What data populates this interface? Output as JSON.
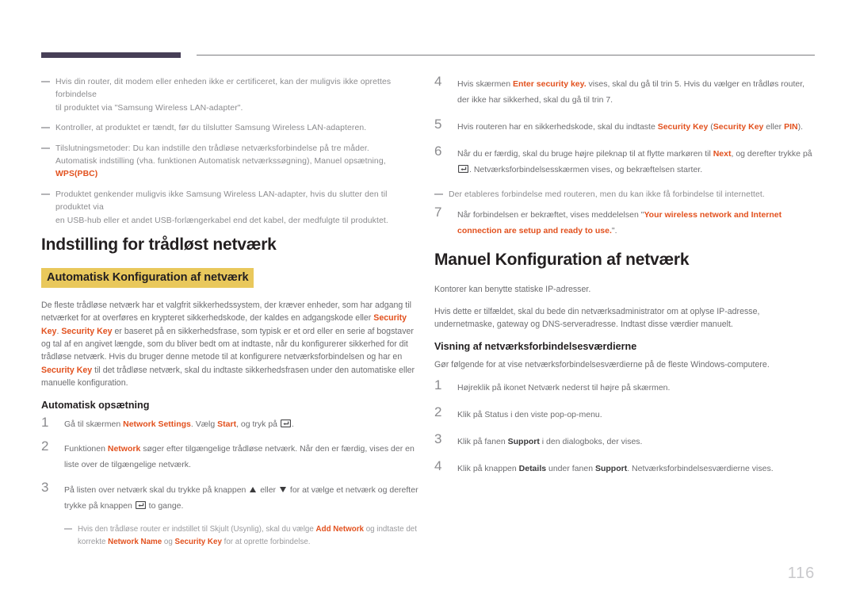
{
  "page": {
    "number": "116",
    "accent_orange": "#e2511e",
    "highlight_yellow": "#e9c85c",
    "header_bar_color": "#473f57",
    "header_line_color": "#7d7d80"
  },
  "left_column": {
    "notes": [
      {
        "id": "note-router-not-certified",
        "lines": [
          "Hvis din router, dit modem eller enheden ikke er certificeret, kan der muligvis ikke oprettes forbindelse",
          "til produktet via \"Samsung Wireless LAN-adapter\"."
        ]
      },
      {
        "id": "note-product-on",
        "lines": [
          "Kontroller, at produktet er tændt, før du tilslutter Samsung Wireless LAN-adapteren."
        ]
      },
      {
        "id": "note-connection-methods",
        "lines": [
          "Tilslutningsmetoder: Du kan indstille den trådløse netværksforbindelse på tre måder.",
          "Automatisk indstilling (vha. funktionen Automatisk netværkssøgning), Manuel opsætning, "
        ],
        "trailing_bold": "WPS(PBC)"
      },
      {
        "id": "note-usb-hub",
        "lines": [
          "Produktet genkender muligvis ikke Samsung Wireless LAN-adapter, hvis du slutter den til produktet via",
          "en USB-hub eller et andet USB-forlængerkabel end det kabel, der medfulgte til produktet."
        ]
      }
    ],
    "section_title": "Indstilling for trådløst netværk",
    "highlight_heading": "Automatisk Konfiguration af netværk",
    "intro_paragraph": {
      "l1_a": "De fleste trådløse netværk har et valgfrit sikkerhedssystem, der kræver enheder, som har adgang til",
      "l2_a": "netværket for at overføres en krypteret sikkerhedskode, der kaldes en adgangskode eller ",
      "l2_b": "Security Key",
      "l2_c": ".",
      "l3_a": "Security Key",
      "l3_b": " er baseret på en sikkerhedsfrase, som typisk er et ord eller en serie af bogstaver og tal af en",
      "l4_a": "angivet længde, som du bliver bedt om at indtaste, når du konfigurerer sikkerhed for dit trådløse netværk.",
      "l5_a": "Hvis du bruger denne metode til at konfigurere netværksforbindelsen og har en ",
      "l5_b": "Security Key",
      "l5_c": " til det",
      "l6_a": "trådløse netværk, skal du indtaste sikkerhedsfrasen under den automatiske eller manuelle konfiguration."
    },
    "sub_title": "Automatisk opsætning",
    "steps": [
      {
        "num": "1",
        "parts": [
          {
            "t": "Gå til skærmen ",
            "s": "plain"
          },
          {
            "t": "Network Settings",
            "s": "orange"
          },
          {
            "t": ". Vælg ",
            "s": "plain"
          },
          {
            "t": "Start",
            "s": "orange"
          },
          {
            "t": ", og tryk på ",
            "s": "plain"
          },
          {
            "t": "[enter-key]",
            "s": "icon-enter"
          },
          {
            "t": ".",
            "s": "plain"
          }
        ]
      },
      {
        "num": "2",
        "parts": [
          {
            "t": "Funktionen ",
            "s": "plain"
          },
          {
            "t": "Network",
            "s": "orange"
          },
          {
            "t": " søger efter tilgængelige trådløse netværk. Når den er færdig, vises der en liste over de tilgængelige netværk.",
            "s": "plain"
          }
        ]
      },
      {
        "num": "3",
        "parts": [
          {
            "t": "På listen over netværk skal du trykke på knappen ",
            "s": "plain"
          },
          {
            "t": "[tri-up]",
            "s": "icon-tri-up"
          },
          {
            "t": " eller ",
            "s": "plain"
          },
          {
            "t": "[tri-down]",
            "s": "icon-tri-down"
          },
          {
            "t": " for at vælge et netværk og derefter trykke på knappen ",
            "s": "plain"
          },
          {
            "t": "[enter-key]",
            "s": "icon-enter"
          },
          {
            "t": " to gange.",
            "s": "plain"
          }
        ]
      }
    ],
    "subnote": {
      "p1": "Hvis den trådløse router er indstillet til Skjult (Usynlig), skal du vælge ",
      "b1": "Add Network",
      "p2": " og indtaste det korrekte ",
      "b2": "Network Name",
      "p3": " og ",
      "b3": "Security Key",
      "p4": " for at oprette forbindelse."
    }
  },
  "right_column": {
    "steps_top": [
      {
        "num": "4",
        "parts": [
          {
            "t": "Hvis skærmen ",
            "s": "plain"
          },
          {
            "t": "Enter security key.",
            "s": "orange"
          },
          {
            "t": " vises, skal du gå til trin 5. Hvis du vælger en trådløs router, der ikke har sikkerhed, skal du gå til trin 7.",
            "s": "plain"
          }
        ]
      },
      {
        "num": "5",
        "parts": [
          {
            "t": "Hvis routeren har en sikkerhedskode, skal du indtaste ",
            "s": "plain"
          },
          {
            "t": "Security Key",
            "s": "orange"
          },
          {
            "t": " (",
            "s": "plain"
          },
          {
            "t": "Security Key",
            "s": "orange"
          },
          {
            "t": " eller ",
            "s": "plain"
          },
          {
            "t": "PIN",
            "s": "orange"
          },
          {
            "t": ").",
            "s": "plain"
          }
        ]
      },
      {
        "num": "6",
        "parts": [
          {
            "t": "Når du er færdig, skal du bruge højre pileknap til at flytte markøren til ",
            "s": "plain"
          },
          {
            "t": "Next",
            "s": "orange"
          },
          {
            "t": ", og derefter trykke på ",
            "s": "plain"
          },
          {
            "t": "[enter-key]",
            "s": "icon-enter"
          },
          {
            "t": ". Netværksforbindelsesskærmen vises, og bekræftelsen starter.",
            "s": "plain"
          }
        ]
      }
    ],
    "note_internet": "Der etableres forbindelse med routeren, men du kan ikke få forbindelse til internettet.",
    "step_seven": {
      "num": "7",
      "p1": "Når forbindelsen er bekræftet, vises meddelelsen \"",
      "b1": "Your wireless network and Internet connection",
      "b2": "are setup and ready to use.",
      "p2": "\"."
    },
    "section_title": "Manuel Konfiguration af netværk",
    "para_offices": "Kontorer kan benytte statiske IP-adresser.",
    "para_admin": "Hvis dette er tilfældet, skal du bede din netværksadministrator om at oplyse IP-adresse, undernetmaske, gateway og DNS-serveradresse. Indtast disse værdier manuelt.",
    "sub_title": "Visning af netværksforbindelsesværdierne",
    "para_windows": "Gør følgende for at vise netværksforbindelsesværdierne på de fleste Windows-computere.",
    "steps_bottom": [
      {
        "num": "1",
        "parts": [
          {
            "t": "Højreklik på ikonet Netværk nederst til højre på skærmen.",
            "s": "plain"
          }
        ]
      },
      {
        "num": "2",
        "parts": [
          {
            "t": "Klik på Status i den viste pop-op-menu.",
            "s": "plain"
          }
        ]
      },
      {
        "num": "3",
        "parts": [
          {
            "t": "Klik på fanen ",
            "s": "plain"
          },
          {
            "t": "Support",
            "s": "dark"
          },
          {
            "t": " i den dialogboks, der vises.",
            "s": "plain"
          }
        ]
      },
      {
        "num": "4",
        "parts": [
          {
            "t": "Klik på knappen ",
            "s": "plain"
          },
          {
            "t": "Details",
            "s": "dark"
          },
          {
            "t": " under fanen ",
            "s": "plain"
          },
          {
            "t": "Support",
            "s": "dark"
          },
          {
            "t": ". Netværksforbindelsesværdierne vises.",
            "s": "plain"
          }
        ]
      }
    ]
  }
}
